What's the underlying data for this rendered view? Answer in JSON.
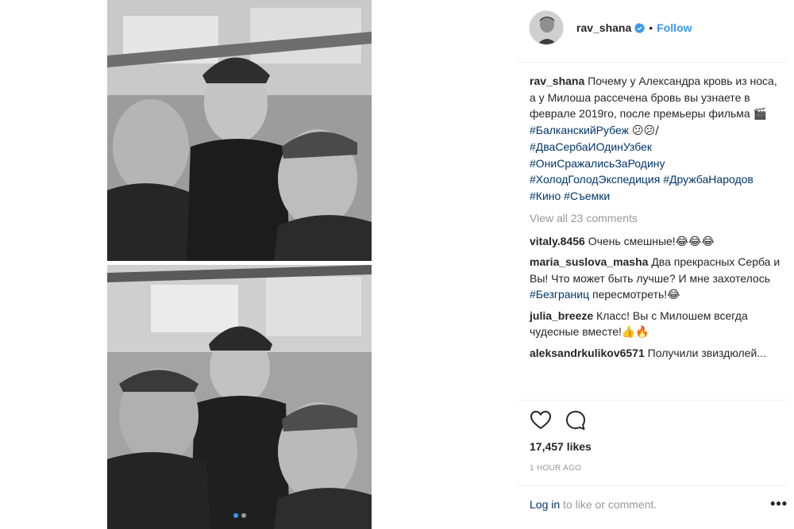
{
  "post": {
    "photos": [
      {
        "alt": "photo-1"
      },
      {
        "alt": "photo-2"
      }
    ],
    "carousel": {
      "count": 2,
      "active": 0
    }
  },
  "header": {
    "username": "rav_shana",
    "verified": true,
    "separator": "•",
    "follow_label": "Follow"
  },
  "caption": {
    "username": "rav_shana",
    "text_1": "Почему у Александра кровь из носа, а у Милоша рассечена бровь вы узнаете в феврале 2019го, после премьеры фильма 🎬",
    "tag_1": "#БалканскийРубеж",
    "text_2": "😕😕/ ",
    "tag_2": "#ДваСербаИОдинУзбек",
    "tag_3": "#ОниСражалисьЗаРодину",
    "tag_4": "#ХолодГолодЭкспедиция",
    "tag_5": "#ДружбаНародов",
    "tag_6": "#Кино",
    "tag_7": "#Съемки"
  },
  "view_all_comments": "View all 23 comments",
  "comments": [
    {
      "user": "vitaly.8456",
      "text": "Очень смешные!😂😂😂"
    },
    {
      "user": "maria_suslova_masha",
      "text_1": "Два прекрасных Серба и Вы! Что может быть лучше? И мне захотелось ",
      "tag": "#Безграниц",
      "text_2": " пересмотреть!😂"
    },
    {
      "user": "julia_breeze",
      "text": "Класс! Вы с Милошем всегда чудесные вместе!👍🔥"
    },
    {
      "user": "aleksandrkulikov6571",
      "text": "Получили звиздюлей..."
    }
  ],
  "actions": {
    "like_icon": "heart-icon",
    "comment_icon": "comment-bubble-icon"
  },
  "likes": "17,457 likes",
  "timestamp": "1 HOUR AGO",
  "login": {
    "link": "Log in",
    "text": " to like or comment."
  },
  "more_label": "•••",
  "colors": {
    "accent": "#3897f0",
    "hashtag": "#003569",
    "muted": "#999999",
    "text": "#262626"
  }
}
